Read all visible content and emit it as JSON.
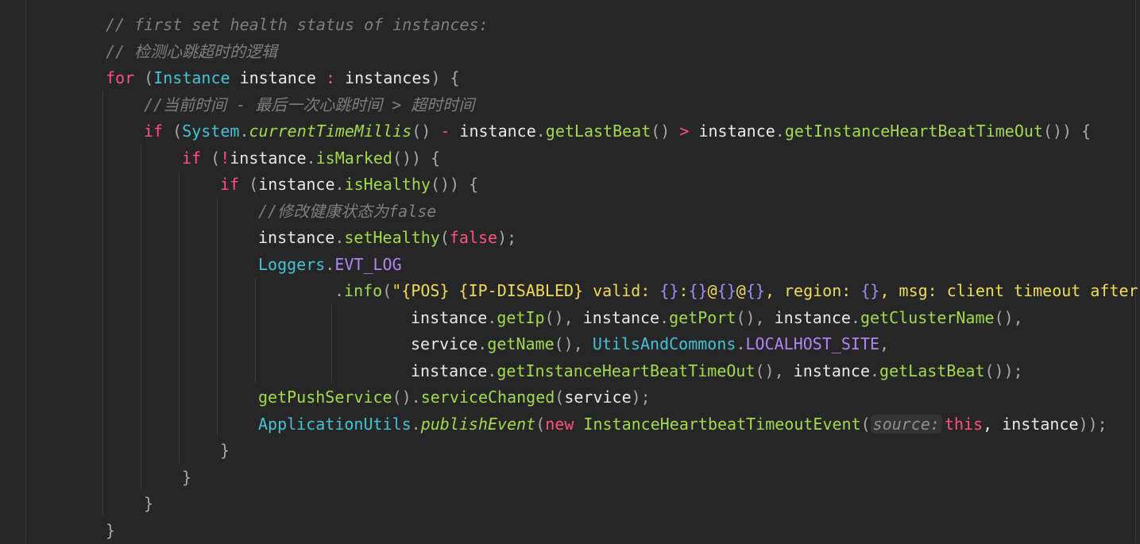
{
  "colors": {
    "background": "#262626",
    "comment": "#7e7e7e",
    "keyword": "#ff4f81",
    "type": "#42c3d8",
    "plain": "#e8e8e8",
    "method": "#a4d94a",
    "field": "#b084f5",
    "string": "#f2da55",
    "hint": "#8f8f8f"
  },
  "lines": [
    {
      "indent": 0,
      "tokens": [
        {
          "t": "// first set health status of instances:",
          "k": "comment"
        }
      ]
    },
    {
      "indent": 0,
      "tokens": [
        {
          "t": "// 检测心跳超时的逻辑",
          "k": "comment"
        }
      ]
    },
    {
      "indent": 0,
      "tokens": [
        {
          "t": "for",
          "k": "kw"
        },
        {
          "t": " (",
          "k": "punct"
        },
        {
          "t": "Instance",
          "k": "type"
        },
        {
          "t": " instance ",
          "k": "plain"
        },
        {
          "t": ":",
          "k": "op"
        },
        {
          "t": " instances",
          "k": "plain"
        },
        {
          "t": ") {",
          "k": "punct"
        }
      ]
    },
    {
      "indent": 1,
      "tokens": [
        {
          "t": "//当前时间 - 最后一次心跳时间 > 超时时间",
          "k": "comment"
        }
      ]
    },
    {
      "indent": 1,
      "tokens": [
        {
          "t": "if",
          "k": "kw"
        },
        {
          "t": " (",
          "k": "punct"
        },
        {
          "t": "System",
          "k": "type"
        },
        {
          "t": ".",
          "k": "punct"
        },
        {
          "t": "currentTimeMillis",
          "k": "static"
        },
        {
          "t": "() ",
          "k": "punct"
        },
        {
          "t": "-",
          "k": "op"
        },
        {
          "t": " instance",
          "k": "plain"
        },
        {
          "t": ".",
          "k": "punct"
        },
        {
          "t": "getLastBeat",
          "k": "method"
        },
        {
          "t": "() ",
          "k": "punct"
        },
        {
          "t": ">",
          "k": "op"
        },
        {
          "t": " instance",
          "k": "plain"
        },
        {
          "t": ".",
          "k": "punct"
        },
        {
          "t": "getInstanceHeartBeatTimeOut",
          "k": "method"
        },
        {
          "t": "()) {",
          "k": "punct"
        }
      ]
    },
    {
      "indent": 2,
      "tokens": [
        {
          "t": "if",
          "k": "kw"
        },
        {
          "t": " (",
          "k": "punct"
        },
        {
          "t": "!",
          "k": "op"
        },
        {
          "t": "instance",
          "k": "plain"
        },
        {
          "t": ".",
          "k": "punct"
        },
        {
          "t": "isMarked",
          "k": "method"
        },
        {
          "t": "()) {",
          "k": "punct"
        }
      ]
    },
    {
      "indent": 3,
      "tokens": [
        {
          "t": "if",
          "k": "kw"
        },
        {
          "t": " (",
          "k": "punct"
        },
        {
          "t": "instance",
          "k": "plain"
        },
        {
          "t": ".",
          "k": "punct"
        },
        {
          "t": "isHealthy",
          "k": "method"
        },
        {
          "t": "()) {",
          "k": "punct"
        }
      ]
    },
    {
      "indent": 4,
      "tokens": [
        {
          "t": "//修改健康状态为false",
          "k": "comment"
        }
      ]
    },
    {
      "indent": 4,
      "tokens": [
        {
          "t": "instance",
          "k": "plain"
        },
        {
          "t": ".",
          "k": "punct"
        },
        {
          "t": "setHealthy",
          "k": "method"
        },
        {
          "t": "(",
          "k": "punct"
        },
        {
          "t": "false",
          "k": "kw"
        },
        {
          "t": ");",
          "k": "punct"
        }
      ]
    },
    {
      "indent": 4,
      "tokens": [
        {
          "t": "Loggers",
          "k": "type"
        },
        {
          "t": ".",
          "k": "punct"
        },
        {
          "t": "EVT_LOG",
          "k": "field"
        }
      ]
    },
    {
      "indent": 6,
      "tokens": [
        {
          "t": ".",
          "k": "punct"
        },
        {
          "t": "info",
          "k": "method"
        },
        {
          "t": "(",
          "k": "punct"
        },
        {
          "t": "\"{POS} {IP-DISABLED} valid: ",
          "k": "string"
        },
        {
          "t": "{}",
          "k": "fmt"
        },
        {
          "t": ":",
          "k": "string"
        },
        {
          "t": "{}",
          "k": "fmt"
        },
        {
          "t": "@",
          "k": "string"
        },
        {
          "t": "{}",
          "k": "fmt"
        },
        {
          "t": "@",
          "k": "string"
        },
        {
          "t": "{}",
          "k": "fmt"
        },
        {
          "t": ", region: ",
          "k": "string"
        },
        {
          "t": "{}",
          "k": "fmt"
        },
        {
          "t": ", msg: client timeout after",
          "k": "string"
        }
      ]
    },
    {
      "indent": 8,
      "tokens": [
        {
          "t": "instance",
          "k": "plain"
        },
        {
          "t": ".",
          "k": "punct"
        },
        {
          "t": "getIp",
          "k": "method"
        },
        {
          "t": "(), ",
          "k": "punct"
        },
        {
          "t": "instance",
          "k": "plain"
        },
        {
          "t": ".",
          "k": "punct"
        },
        {
          "t": "getPort",
          "k": "method"
        },
        {
          "t": "(), ",
          "k": "punct"
        },
        {
          "t": "instance",
          "k": "plain"
        },
        {
          "t": ".",
          "k": "punct"
        },
        {
          "t": "getClusterName",
          "k": "method"
        },
        {
          "t": "(),",
          "k": "punct"
        }
      ]
    },
    {
      "indent": 8,
      "tokens": [
        {
          "t": "service",
          "k": "plain"
        },
        {
          "t": ".",
          "k": "punct"
        },
        {
          "t": "getName",
          "k": "method"
        },
        {
          "t": "(), ",
          "k": "punct"
        },
        {
          "t": "UtilsAndCommons",
          "k": "type"
        },
        {
          "t": ".",
          "k": "punct"
        },
        {
          "t": "LOCALHOST_SITE",
          "k": "field"
        },
        {
          "t": ",",
          "k": "punct"
        }
      ]
    },
    {
      "indent": 8,
      "tokens": [
        {
          "t": "instance",
          "k": "plain"
        },
        {
          "t": ".",
          "k": "punct"
        },
        {
          "t": "getInstanceHeartBeatTimeOut",
          "k": "method"
        },
        {
          "t": "(), ",
          "k": "punct"
        },
        {
          "t": "instance",
          "k": "plain"
        },
        {
          "t": ".",
          "k": "punct"
        },
        {
          "t": "getLastBeat",
          "k": "method"
        },
        {
          "t": "());",
          "k": "punct"
        }
      ]
    },
    {
      "indent": 4,
      "tokens": [
        {
          "t": "getPushService",
          "k": "method"
        },
        {
          "t": "().",
          "k": "punct"
        },
        {
          "t": "serviceChanged",
          "k": "method"
        },
        {
          "t": "(",
          "k": "punct"
        },
        {
          "t": "service",
          "k": "plain"
        },
        {
          "t": ");",
          "k": "punct"
        }
      ]
    },
    {
      "indent": 4,
      "tokens": [
        {
          "t": "ApplicationUtils",
          "k": "type"
        },
        {
          "t": ".",
          "k": "punct"
        },
        {
          "t": "publishEvent",
          "k": "static"
        },
        {
          "t": "(",
          "k": "punct"
        },
        {
          "t": "new",
          "k": "kw"
        },
        {
          "t": " ",
          "k": "plain"
        },
        {
          "t": "InstanceHeartbeatTimeoutEvent",
          "k": "method"
        },
        {
          "t": "(",
          "k": "punct"
        },
        {
          "t": "source:",
          "k": "hint"
        },
        {
          "t": "this",
          "k": "kw"
        },
        {
          "t": ", instance",
          "k": "plain"
        },
        {
          "t": "));",
          "k": "punct"
        }
      ]
    },
    {
      "indent": 3,
      "tokens": [
        {
          "t": "}",
          "k": "punct"
        }
      ]
    },
    {
      "indent": 2,
      "tokens": [
        {
          "t": "}",
          "k": "punct"
        }
      ]
    },
    {
      "indent": 1,
      "tokens": [
        {
          "t": "}",
          "k": "punct"
        }
      ]
    },
    {
      "indent": 0,
      "tokens": [
        {
          "t": "}",
          "k": "punct"
        }
      ]
    }
  ]
}
